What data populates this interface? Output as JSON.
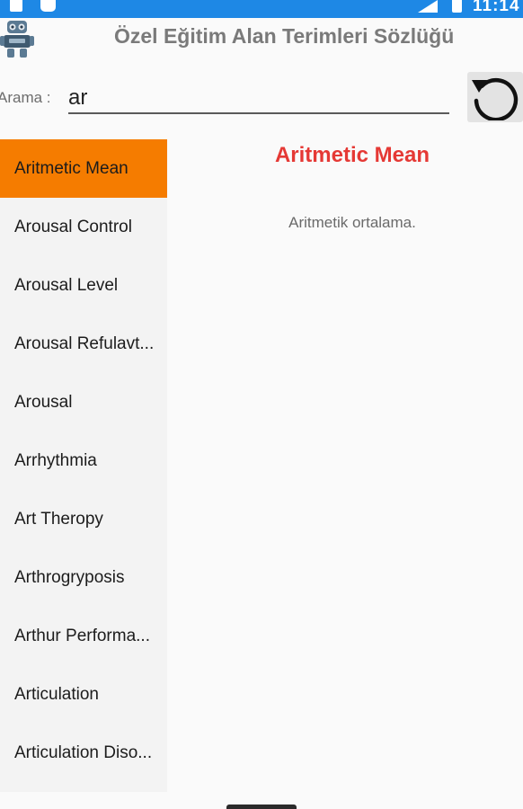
{
  "status_bar": {
    "time": "11:14",
    "icons": [
      "notification-icon",
      "notification-icon",
      "signal-icon",
      "battery-icon"
    ]
  },
  "header": {
    "title": "Özel Eğitim Alan Terimleri Sözlüğü",
    "logo_icon": "robot-logo-icon"
  },
  "search": {
    "label": "Arama :",
    "value": "ar",
    "reset_icon": "refresh-icon"
  },
  "terms": {
    "items": [
      {
        "label": "Aritmetic Mean",
        "selected": true
      },
      {
        "label": "Arousal Control",
        "selected": false
      },
      {
        "label": "Arousal Level",
        "selected": false
      },
      {
        "label": "Arousal Refulavt...",
        "selected": false
      },
      {
        "label": "Arousal",
        "selected": false
      },
      {
        "label": "Arrhythmia",
        "selected": false
      },
      {
        "label": "Art Theropy",
        "selected": false
      },
      {
        "label": "Arthrogryposis",
        "selected": false
      },
      {
        "label": "Arthur Performa...",
        "selected": false
      },
      {
        "label": "Articulation",
        "selected": false
      },
      {
        "label": "Articulation Diso...",
        "selected": false
      }
    ]
  },
  "detail": {
    "title": "Aritmetic Mean",
    "definition": "Aritmetik ortalama."
  },
  "colors": {
    "status_bar": "#1e88e5",
    "selected_item": "#f57c00",
    "detail_title": "#e53935"
  }
}
